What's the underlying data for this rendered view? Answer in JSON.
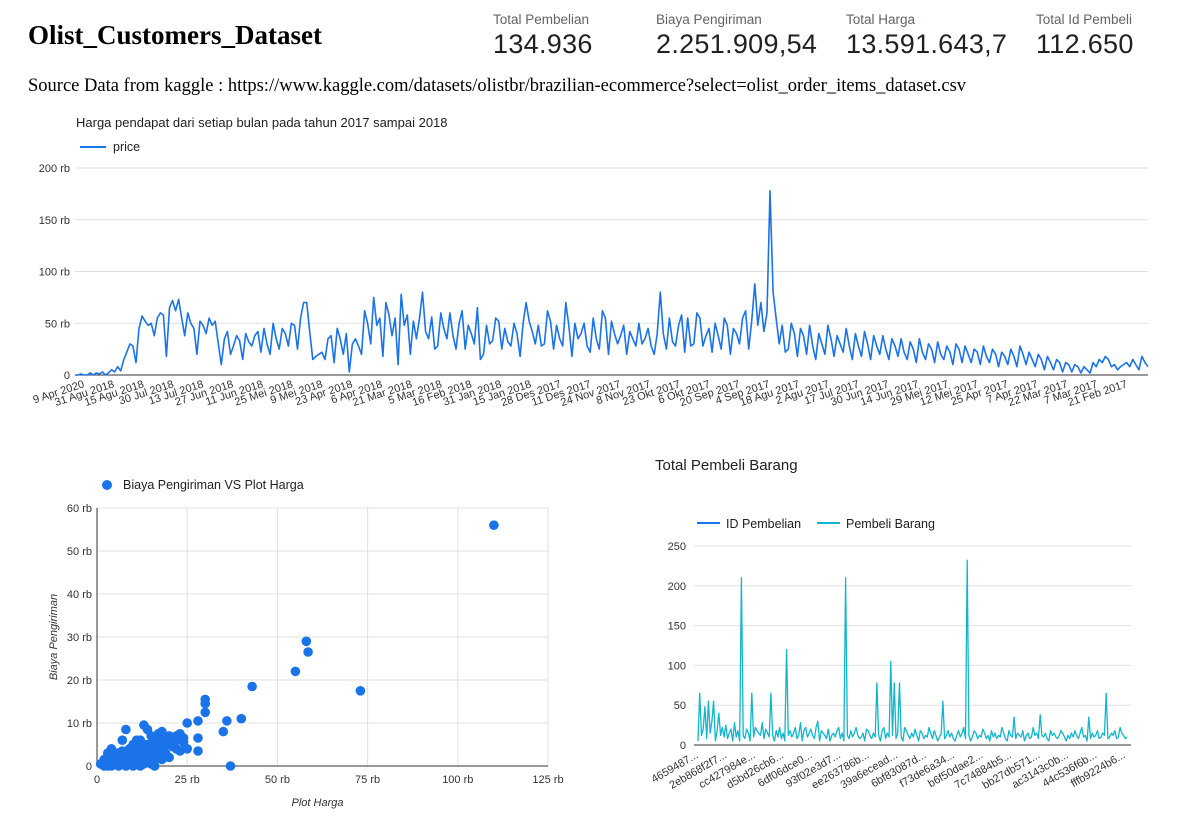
{
  "dashboard": {
    "title": "Olist_Customers_Dataset",
    "source": "Source Data from kaggle : https://www.kaggle.com/datasets/olistbr/brazilian-ecommerce?select=olist_order_items_dataset.csv"
  },
  "kpis": [
    {
      "label": "Total Pembelian",
      "value": "134.936"
    },
    {
      "label": "Biaya Pengiriman",
      "value": "2.251.909,54"
    },
    {
      "label": "Total Harga",
      "value": "13.591.643,7"
    },
    {
      "label": "Total Id Pembeli",
      "value": "112.650"
    }
  ],
  "colors": {
    "primary": "#1a73e8",
    "secondary": "#12b5cb",
    "scatter": "#1a73e8"
  },
  "chart_data": [
    {
      "type": "line",
      "title": "Harga pendapat dari setiap bulan pada tahun 2017 sampai 2018",
      "legend_position": "top-left",
      "ylim": [
        0,
        200000
      ],
      "y_ticks": [
        "0",
        "50 rb",
        "100 rb",
        "150 rb",
        "200 rb"
      ],
      "x_ticks": [
        "9 Apr 2020",
        "31 Agu 2018",
        "15 Agu 2018",
        "30 Jul 2018",
        "13 Jul 2018",
        "27 Jun 2018",
        "11 Jun 2018",
        "25 Mei 2018",
        "9 Mei 2018",
        "23 Apr 2018",
        "6 Apr 2018",
        "21 Mar 2018",
        "5 Mar 2018",
        "16 Feb 2018",
        "31 Jan 2018",
        "15 Jan 2018",
        "28 Des 2017",
        "11 Des 2017",
        "24 Nov 2017",
        "8 Nov 2017",
        "23 Okt 2017",
        "6 Okt 2017",
        "20 Sep 2017",
        "4 Sep 2017",
        "18 Agu 2017",
        "2 Agu 2017",
        "17 Jul 2017",
        "30 Jun 2017",
        "14 Jun 2017",
        "29 Mei 2017",
        "12 Mei 2017",
        "25 Apr 2017",
        "7 Apr 2017",
        "22 Mar 2017",
        "7 Mar 2017",
        "21 Feb 2017"
      ],
      "series": [
        {
          "name": "price",
          "color": "#1a73e8",
          "values": [
            0,
            0,
            1000,
            0,
            0,
            2000,
            0,
            2000,
            1000,
            3000,
            0,
            2000,
            5000,
            3000,
            8000,
            4000,
            15000,
            22000,
            30000,
            28000,
            12000,
            45000,
            57000,
            52000,
            48000,
            50000,
            38000,
            55000,
            60000,
            58000,
            18000,
            65000,
            72000,
            62000,
            73000,
            55000,
            38000,
            60000,
            50000,
            45000,
            20000,
            52000,
            48000,
            40000,
            55000,
            48000,
            52000,
            30000,
            10000,
            35000,
            42000,
            20000,
            28000,
            38000,
            33000,
            15000,
            40000,
            32000,
            28000,
            38000,
            42000,
            22000,
            45000,
            30000,
            20000,
            50000,
            35000,
            25000,
            45000,
            40000,
            28000,
            50000,
            48000,
            25000,
            55000,
            70000,
            70000,
            42000,
            15000,
            18000,
            20000,
            22000,
            15000,
            35000,
            38000,
            12000,
            45000,
            35000,
            20000,
            40000,
            3000,
            30000,
            35000,
            28000,
            20000,
            62000,
            50000,
            30000,
            75000,
            48000,
            55000,
            18000,
            70000,
            58000,
            38000,
            55000,
            10000,
            78000,
            48000,
            58000,
            20000,
            52000,
            35000,
            55000,
            80000,
            42000,
            35000,
            56000,
            25000,
            28000,
            60000,
            45000,
            35000,
            60000,
            38000,
            25000,
            50000,
            62000,
            25000,
            48000,
            40000,
            30000,
            65000,
            15000,
            20000,
            48000,
            30000,
            33000,
            55000,
            52000,
            25000,
            45000,
            32000,
            28000,
            50000,
            40000,
            18000,
            50000,
            70000,
            52000,
            42000,
            30000,
            48000,
            28000,
            30000,
            62000,
            52000,
            25000,
            48000,
            35000,
            28000,
            70000,
            48000,
            18000,
            50000,
            35000,
            40000,
            50000,
            28000,
            22000,
            55000,
            35000,
            25000,
            62000,
            55000,
            20000,
            52000,
            40000,
            30000,
            38000,
            48000,
            20000,
            42000,
            35000,
            28000,
            50000,
            30000,
            35000,
            45000,
            28000,
            20000,
            40000,
            80000,
            40000,
            25000,
            55000,
            32000,
            28000,
            48000,
            58000,
            22000,
            55000,
            28000,
            30000,
            60000,
            55000,
            28000,
            38000,
            45000,
            22000,
            50000,
            38000,
            25000,
            55000,
            48000,
            20000,
            45000,
            40000,
            30000,
            55000,
            62000,
            25000,
            52000,
            88000,
            48000,
            70000,
            42000,
            60000,
            178000,
            80000,
            55000,
            30000,
            48000,
            22000,
            25000,
            50000,
            40000,
            18000,
            45000,
            38000,
            20000,
            48000,
            28000,
            15000,
            40000,
            30000,
            20000,
            48000,
            35000,
            18000,
            38000,
            30000,
            22000,
            45000,
            28000,
            15000,
            40000,
            28000,
            18000,
            42000,
            30000,
            15000,
            38000,
            28000,
            20000,
            38000,
            25000,
            15000,
            35000,
            28000,
            18000,
            35000,
            22000,
            15000,
            32000,
            25000,
            12000,
            35000,
            22000,
            15000,
            30000,
            25000,
            12000,
            32000,
            20000,
            15000,
            28000,
            22000,
            10000,
            30000,
            25000,
            12000,
            28000,
            20000,
            12000,
            25000,
            22000,
            10000,
            28000,
            18000,
            12000,
            25000,
            20000,
            8000,
            22000,
            18000,
            10000,
            25000,
            18000,
            8000,
            28000,
            20000,
            10000,
            22000,
            15000,
            8000,
            20000,
            15000,
            5000,
            18000,
            12000,
            5000,
            15000,
            12000,
            3000,
            12000,
            10000,
            3000,
            10000,
            8000,
            2000,
            8000,
            5000,
            2000,
            12000,
            8000,
            15000,
            12000,
            18000,
            15000,
            8000,
            10000,
            5000,
            8000,
            10000,
            12000,
            8000,
            15000,
            10000,
            5000,
            18000,
            12000,
            8000
          ]
        }
      ]
    },
    {
      "type": "scatter",
      "legend": "Biaya Pengiriman VS Plot Harga",
      "legend_position": "top-left",
      "xlabel": "Plot Harga",
      "ylabel": "Biaya Pengiriman",
      "xlim": [
        0,
        125000
      ],
      "ylim": [
        0,
        60000
      ],
      "x_ticks": [
        "0",
        "25 rb",
        "50 rb",
        "75 rb",
        "100 rb",
        "125 rb"
      ],
      "y_ticks": [
        "0",
        "10 rb",
        "20 rb",
        "30 rb",
        "40 rb",
        "50 rb",
        "60 rb"
      ],
      "points": [
        [
          110000,
          56000
        ],
        [
          58000,
          29000
        ],
        [
          58500,
          26500
        ],
        [
          55000,
          22000
        ],
        [
          73000,
          17500
        ],
        [
          43000,
          18500
        ],
        [
          40000,
          11000
        ],
        [
          36000,
          10500
        ],
        [
          30000,
          15500
        ],
        [
          30000,
          14500
        ],
        [
          30000,
          12500
        ],
        [
          28000,
          10500
        ],
        [
          28000,
          6500
        ],
        [
          28000,
          3500
        ],
        [
          37000,
          0
        ],
        [
          35000,
          8000
        ],
        [
          25000,
          10000
        ],
        [
          22000,
          6000
        ],
        [
          20000,
          7000
        ],
        [
          18000,
          8000
        ],
        [
          17000,
          7500
        ],
        [
          16000,
          6500
        ],
        [
          15000,
          7000
        ],
        [
          14000,
          8500
        ],
        [
          13000,
          9500
        ],
        [
          12000,
          6000
        ],
        [
          12000,
          5000
        ],
        [
          11000,
          6000
        ],
        [
          10000,
          5000
        ],
        [
          9000,
          4000
        ],
        [
          8000,
          8500
        ],
        [
          7000,
          6000
        ],
        [
          6000,
          3000
        ],
        [
          6000,
          2500
        ],
        [
          5000,
          3000
        ],
        [
          5000,
          2000
        ],
        [
          4000,
          2000
        ],
        [
          3000,
          1000
        ],
        [
          3000,
          500
        ],
        [
          2000,
          500
        ],
        [
          2000,
          1500
        ],
        [
          4000,
          3000
        ],
        [
          5000,
          1000
        ],
        [
          6000,
          2000
        ],
        [
          7000,
          1500
        ],
        [
          8000,
          1000
        ],
        [
          9000,
          2000
        ],
        [
          10000,
          1500
        ],
        [
          11000,
          2500
        ],
        [
          12000,
          1000
        ],
        [
          13000,
          2000
        ],
        [
          14000,
          3000
        ],
        [
          15000,
          2500
        ],
        [
          16000,
          1500
        ],
        [
          17000,
          3500
        ],
        [
          18000,
          4000
        ],
        [
          19000,
          3000
        ],
        [
          20000,
          5000
        ],
        [
          21000,
          4500
        ],
        [
          22000,
          4000
        ],
        [
          23000,
          3500
        ],
        [
          24000,
          5500
        ],
        [
          25000,
          4000
        ],
        [
          9000,
          500
        ],
        [
          10000,
          0
        ],
        [
          11000,
          500
        ],
        [
          12000,
          0
        ],
        [
          13000,
          500
        ],
        [
          14000,
          1000
        ],
        [
          15000,
          500
        ],
        [
          16000,
          0
        ],
        [
          17000,
          2000
        ],
        [
          18000,
          1500
        ],
        [
          19000,
          2500
        ],
        [
          20000,
          2000
        ],
        [
          3000,
          3000
        ],
        [
          4000,
          4000
        ],
        [
          7000,
          3500
        ],
        [
          8000,
          2500
        ],
        [
          9000,
          3500
        ],
        [
          10000,
          3000
        ],
        [
          11000,
          3500
        ],
        [
          12000,
          3000
        ],
        [
          13000,
          4000
        ],
        [
          14000,
          5000
        ],
        [
          15000,
          4500
        ],
        [
          16000,
          5500
        ],
        [
          17000,
          5000
        ],
        [
          18000,
          6000
        ],
        [
          19000,
          5500
        ],
        [
          21000,
          6500
        ],
        [
          22000,
          7000
        ],
        [
          23000,
          7500
        ],
        [
          24000,
          6500
        ],
        [
          8000,
          0
        ],
        [
          7000,
          500
        ],
        [
          6000,
          0
        ],
        [
          5000,
          500
        ],
        [
          4000,
          0
        ],
        [
          3000,
          0
        ],
        [
          2000,
          0
        ],
        [
          1000,
          500
        ]
      ]
    },
    {
      "type": "line",
      "title": "Total Pembeli Barang",
      "legend_position": "top-left",
      "ylim": [
        0,
        250
      ],
      "y_ticks": [
        "0",
        "50",
        "100",
        "150",
        "200",
        "250"
      ],
      "x_ticks": [
        "4659487...",
        "2eb868f2f7...",
        "cc427984e...",
        "d5bd26cb6...",
        "6df06dce0...",
        "93f02e3d7...",
        "ee263786b...",
        "39a6ecead...",
        "6bf83087d...",
        "f73de6a34...",
        "b6f50dae2...",
        "7c74884b5...",
        "bb27db571...",
        "ac3143c0b...",
        "44c536f6b...",
        "fffb9224b6..."
      ],
      "series": [
        {
          "name": "ID Pembelian",
          "color": "#1a73e8",
          "values": []
        },
        {
          "name": "Pembeli Barang",
          "color": "#12b5cb",
          "values": [
            5,
            65,
            12,
            20,
            48,
            8,
            55,
            15,
            30,
            55,
            5,
            18,
            40,
            12,
            22,
            10,
            25,
            8,
            15,
            20,
            5,
            28,
            10,
            18,
            5,
            210,
            12,
            8,
            20,
            15,
            5,
            65,
            10,
            22,
            18,
            15,
            12,
            28,
            8,
            20,
            15,
            10,
            65,
            12,
            5,
            18,
            10,
            22,
            8,
            15,
            5,
            120,
            12,
            18,
            10,
            15,
            22,
            8,
            12,
            28,
            5,
            18,
            22,
            10,
            15,
            20,
            12,
            8,
            22,
            30,
            5,
            18,
            15,
            12,
            8,
            20,
            5,
            12,
            15,
            10,
            18,
            22,
            8,
            15,
            5,
            210,
            12,
            8,
            18,
            10,
            15,
            22,
            12,
            8,
            10,
            15,
            5,
            20,
            18,
            12,
            8,
            15,
            10,
            78,
            12,
            5,
            18,
            22,
            8,
            15,
            10,
            105,
            12,
            78,
            8,
            15,
            78,
            10,
            5,
            22,
            18,
            12,
            8,
            15,
            10,
            20,
            12,
            5,
            18,
            15,
            8,
            12,
            10,
            22,
            15,
            8,
            18,
            12,
            5,
            10,
            15,
            55,
            8,
            12,
            18,
            10,
            15,
            8,
            5,
            12,
            18,
            10,
            15,
            22,
            8,
            232,
            12,
            5,
            10,
            18,
            15,
            8,
            12,
            10,
            20,
            15,
            8,
            12,
            5,
            18,
            10,
            15,
            8,
            12,
            10,
            22,
            15,
            8,
            5,
            18,
            12,
            10,
            35,
            8,
            15,
            12,
            10,
            18,
            5,
            12,
            15,
            8,
            10,
            22,
            12,
            15,
            8,
            38,
            12,
            10,
            15,
            8,
            5,
            18,
            12,
            15,
            10,
            8,
            12,
            18,
            15,
            10,
            5,
            12,
            8,
            15,
            10,
            18,
            12,
            8,
            15,
            22,
            10,
            12,
            5,
            35,
            8,
            15,
            10,
            12,
            18,
            8,
            10,
            15,
            12,
            65,
            8,
            10,
            15,
            12,
            18,
            8,
            10,
            22,
            15,
            12,
            8,
            10
          ]
        }
      ]
    }
  ]
}
